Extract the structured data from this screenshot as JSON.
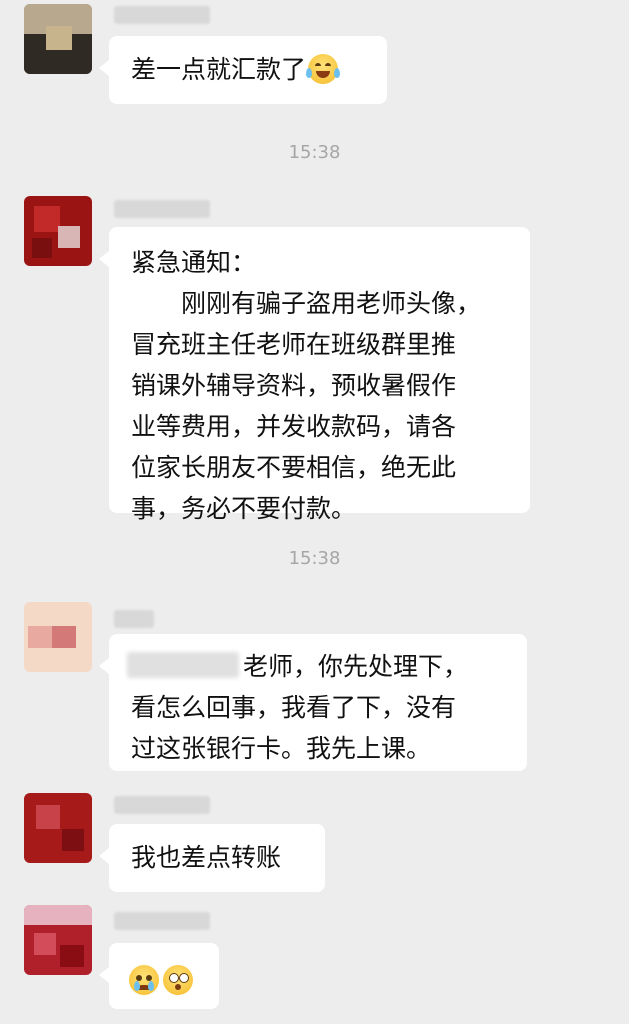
{
  "messages": [
    {
      "text": "差一点就汇款了",
      "emoji": "laugh-cry"
    },
    {
      "lines": [
        "紧急通知：",
        "　　刚刚有骗子盗用老师头像，",
        "冒充班主任老师在班级群里推",
        "销课外辅导资料，预收暑假作",
        "业等费用，并发收款码，请各",
        "位家长朋友不要相信，绝无此",
        "事，务必不要付款。"
      ]
    },
    {
      "lines": [
        "老师，你先处理下，",
        "看怎么回事，我看了下，没有",
        "过这张银行卡。我先上课。"
      ]
    },
    {
      "text": "我也差点转账"
    },
    {
      "emojis": [
        "crying-face",
        "astonished-face"
      ]
    }
  ],
  "timestamps": [
    "15:38",
    "15:38"
  ],
  "colors": {
    "background": "#ededed",
    "bubble": "#ffffff",
    "timestamp": "#a6a6a6"
  }
}
